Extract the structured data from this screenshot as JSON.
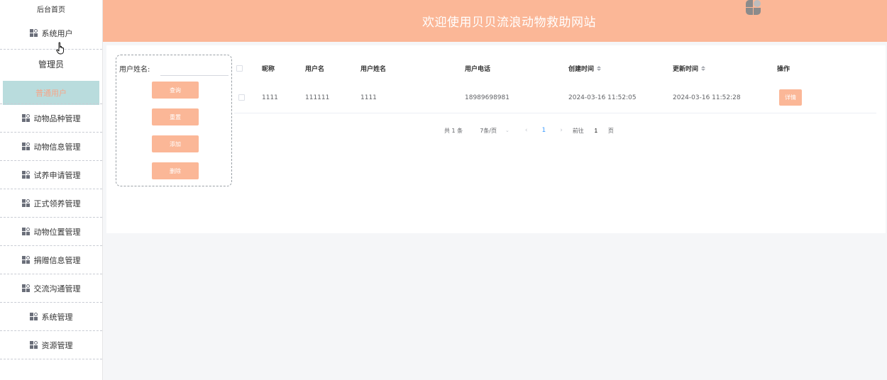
{
  "sidebar": {
    "home": "后台首页",
    "items": [
      {
        "label": "系统用户",
        "sub": [
          "管理员",
          "普通用户"
        ]
      },
      {
        "label": "动物品种管理"
      },
      {
        "label": "动物信息管理"
      },
      {
        "label": "试养申请管理"
      },
      {
        "label": "正式领养管理"
      },
      {
        "label": "动物位置管理"
      },
      {
        "label": "捐赠信息管理"
      },
      {
        "label": "交流沟通管理"
      },
      {
        "label": "系统管理"
      },
      {
        "label": "资源管理"
      }
    ]
  },
  "header": {
    "title": "欢迎使用贝贝流浪动物救助网站"
  },
  "search": {
    "label": "用户姓名:",
    "value": "",
    "buttons": {
      "query": "查询",
      "reset": "重置",
      "add": "添加",
      "delete": "删除"
    }
  },
  "table": {
    "columns": [
      "昵称",
      "用户名",
      "用户姓名",
      "用户电话",
      "创建时间",
      "更新时间",
      "操作"
    ],
    "rows": [
      {
        "nickname": "1111",
        "username": "111111",
        "realname": "1111",
        "phone": "18989698981",
        "created": "2024-03-16 11:52:05",
        "updated": "2024-03-16 11:52:28",
        "action": "详情"
      }
    ]
  },
  "pagination": {
    "total": "共 1 条",
    "page_size": "7条/页",
    "current": "1",
    "goto_label": "前往",
    "goto_value": "1",
    "page_unit": "页"
  },
  "colors": {
    "accent": "#fbb797",
    "active_bg": "#b9dcdd",
    "link": "#409eff"
  }
}
